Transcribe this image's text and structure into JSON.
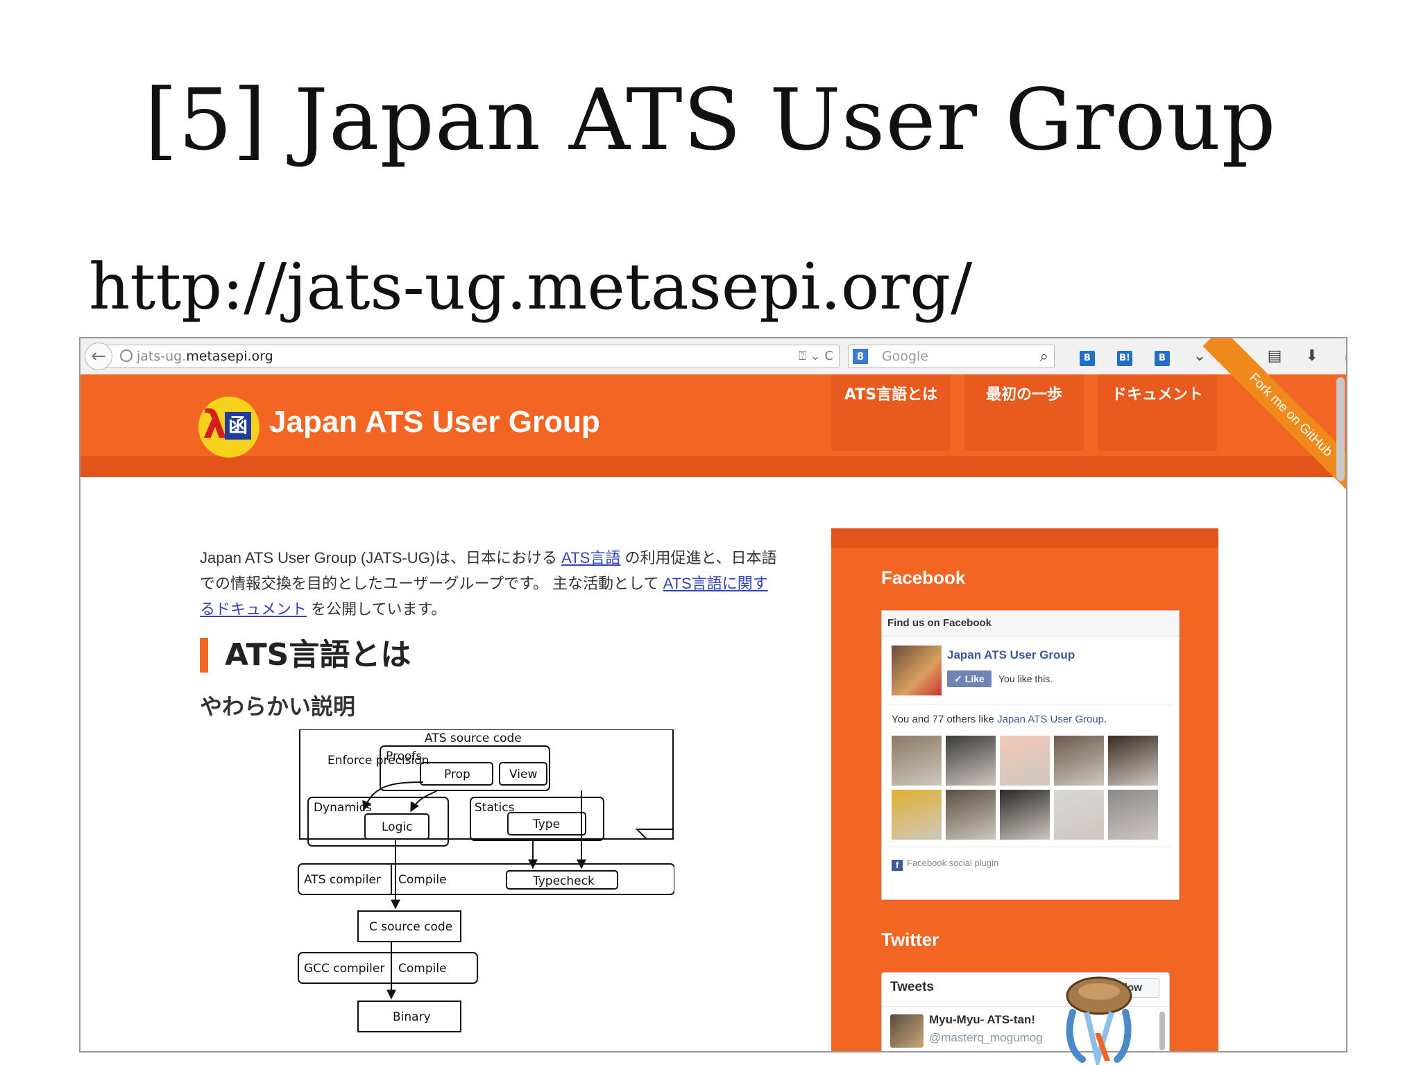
{
  "slide": {
    "title": "[5] Japan ATS User Group",
    "url": "http://jats-ug.metasepi.org/"
  },
  "browser": {
    "url_sub": "jats-ug.",
    "url_host": "metasepi.org",
    "url_tools": "⍰ ⌄ C",
    "search_placeholder": "Google",
    "search_engine_icon": "google-icon",
    "toolbar_icons": [
      "hatena-bookmark-icon",
      "hatena-b-icon",
      "hatena-counter-icon",
      "chevron-down-icon",
      "star-icon",
      "reading-list-icon",
      "download-icon",
      "home-icon",
      "refresh-addon-icon",
      "menu-icon"
    ]
  },
  "site": {
    "title": "Japan ATS User Group",
    "logo": {
      "lambda": "λ",
      "box": "函"
    },
    "nav": [
      "ATS言語とは",
      "最初の一歩",
      "ドキュメント"
    ],
    "ribbon": "Fork me on GitHub",
    "colors": {
      "header": "#f26522",
      "header_dark": "#e2541a",
      "link": "#3344bb"
    }
  },
  "content": {
    "intro_1": "Japan ATS User Group (JATS-UG)は、日本における ",
    "intro_link_1": "ATS言語",
    "intro_2": " の利用促進と、日本語での情報交換を目的としたユーザーグループです。 主な活動として ",
    "intro_link_2": "ATS言語に関するドキュメント",
    "intro_3": " を公開しています。",
    "heading": "ATS言語とは",
    "subheading": "やわらかい説明"
  },
  "diagram": {
    "ats_source": "ATS source code",
    "enforce": "Enforce precision",
    "proofs": "Proofs",
    "prop": "Prop",
    "view": "View",
    "dynamics": "Dynamics",
    "logic": "Logic",
    "statics": "Statics",
    "type": "Type",
    "ats_compiler": "ATS compiler",
    "compile1": "Compile",
    "typecheck": "Typecheck",
    "c_source": "C source code",
    "gcc": "GCC compiler",
    "compile2": "Compile",
    "binary": "Binary"
  },
  "sidebar": {
    "facebook_heading": "Facebook",
    "fb_find": "Find us on Facebook",
    "fb_page": "Japan ATS User Group",
    "fb_like": "✓ Like",
    "fb_like_text": "You like this.",
    "fb_others_pre": "You and 77 others like ",
    "fb_others_link": "Japan ATS User Group",
    "fb_others_post": ".",
    "fb_plugin": "Facebook social plugin",
    "faces": [
      "#8a7a63",
      "#3a3a3a",
      "#f2c9b8",
      "#6b5a4a",
      "#3a2a22",
      "#e0b030",
      "#5a5040",
      "#2a2a2a",
      "#d8d8d8",
      "#8a8a8a"
    ],
    "twitter_heading": "Twitter",
    "tw_title": "Tweets",
    "tw_follow": "Follow",
    "tw_name": "Myu-Myu- ATS-tan!",
    "tw_handle": "@masterq_mogumog"
  }
}
